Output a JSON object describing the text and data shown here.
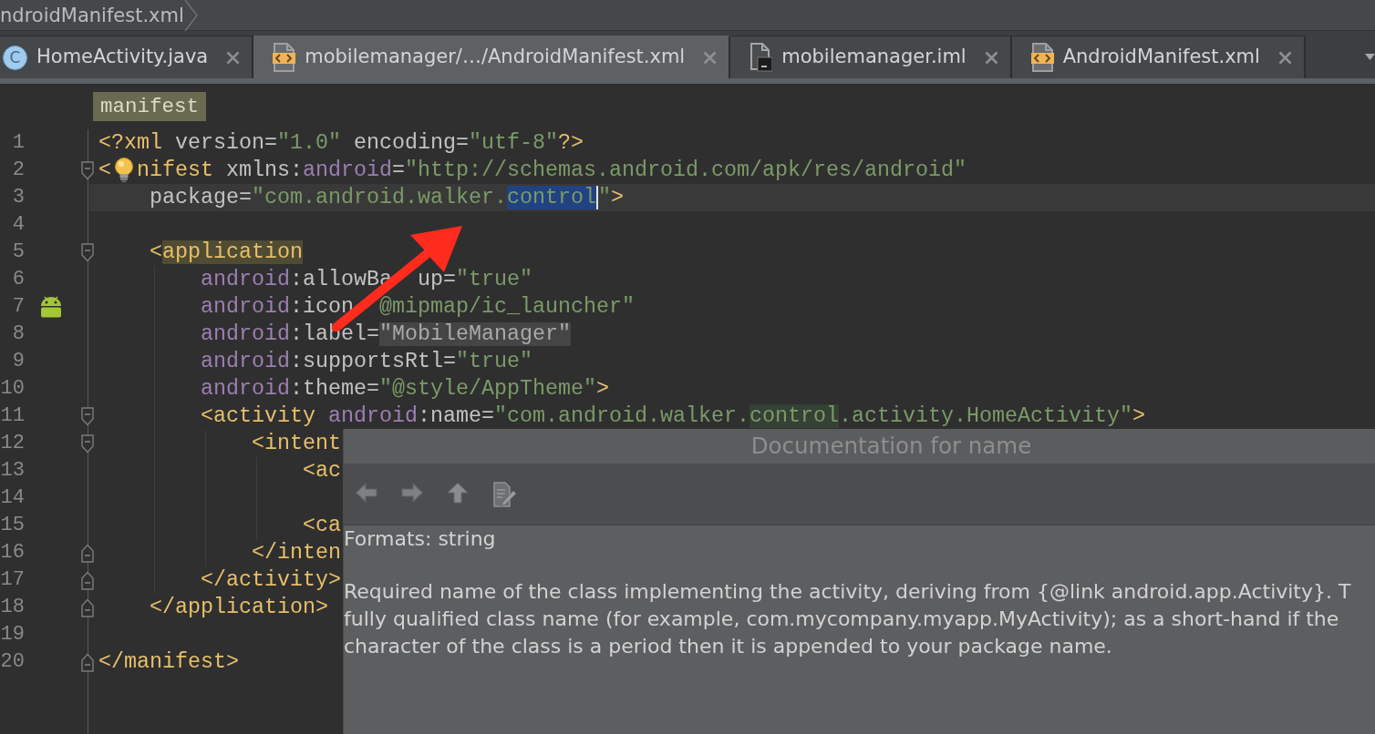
{
  "breadcrumb_bar": {
    "path": "ndroidManifest.xml"
  },
  "tabs": [
    {
      "label": "HomeActivity.java",
      "kind": "class",
      "icon_letter": "C",
      "selected": false
    },
    {
      "label": "mobilemanager/…/AndroidManifest.xml",
      "kind": "xml",
      "selected": true
    },
    {
      "label": "mobilemanager.iml",
      "kind": "module",
      "selected": false
    },
    {
      "label": "AndroidManifest.xml",
      "kind": "xml",
      "selected": false
    }
  ],
  "editor": {
    "breadcrumb_tag": "manifest",
    "lines": [
      {
        "number": "1",
        "current": false,
        "segments": [
          {
            "kind": "tag",
            "text": "<?xml"
          },
          {
            "kind": "plain",
            "text": " version="
          },
          {
            "kind": "value",
            "text": "\"1.0\""
          },
          {
            "kind": "plain",
            "text": " encoding="
          },
          {
            "kind": "value",
            "text": "\"utf-8\""
          },
          {
            "kind": "tag",
            "text": "?>"
          }
        ]
      },
      {
        "number": "2",
        "current": false,
        "fold_marker": {
          "kind": "start"
        },
        "segments": [
          {
            "kind": "tag",
            "text": "<"
          },
          {
            "kind": "bulb"
          },
          {
            "kind": "tag",
            "text": "nifest"
          },
          {
            "kind": "plain",
            "text": " xmlns:"
          },
          {
            "kind": "ns",
            "text": "android"
          },
          {
            "kind": "plain",
            "text": "="
          },
          {
            "kind": "value",
            "text": "\"http://schemas.android.com/apk/res/android\""
          }
        ]
      },
      {
        "number": "3",
        "current": true,
        "segments": [
          {
            "kind": "plain",
            "text": "    package="
          },
          {
            "kind": "value",
            "text": "\"com.android.walker."
          },
          {
            "kind": "value",
            "text": "control",
            "highlight": {
              "kind": "selection"
            }
          },
          {
            "kind": "value",
            "text": "\""
          },
          {
            "kind": "tag",
            "text": ">"
          }
        ]
      },
      {
        "number": "4",
        "current": false
      },
      {
        "number": "5",
        "current": false,
        "fold_marker": {
          "kind": "start"
        },
        "segments": [
          {
            "kind": "tag",
            "text": "    <"
          },
          {
            "kind": "tag",
            "text": "application",
            "highlight": {
              "kind": "tag_match"
            }
          }
        ]
      },
      {
        "number": "6",
        "current": false,
        "segments": [
          {
            "kind": "ns",
            "text": "        android"
          },
          {
            "kind": "plain",
            "text": ":allowBa"
          },
          {
            "kind": "covered"
          },
          {
            "kind": "plain",
            "text": "up="
          },
          {
            "kind": "value",
            "text": "\"true\""
          }
        ]
      },
      {
        "number": "7",
        "current": false,
        "gutter_icon": {
          "kind": "android"
        },
        "segments": [
          {
            "kind": "ns",
            "text": "        android"
          },
          {
            "kind": "plain",
            "text": ":icon"
          },
          {
            "kind": "covered"
          },
          {
            "kind": "value",
            "text": "@mipmap/ic_launcher\""
          }
        ]
      },
      {
        "number": "8",
        "current": false,
        "segments": [
          {
            "kind": "ns",
            "text": "        android"
          },
          {
            "kind": "plain",
            "text": ":label="
          },
          {
            "kind": "value",
            "text": "\"MobileManager\"",
            "highlight": {
              "kind": "folded"
            }
          }
        ]
      },
      {
        "number": "9",
        "current": false,
        "segments": [
          {
            "kind": "ns",
            "text": "        android"
          },
          {
            "kind": "plain",
            "text": ":supportsRtl="
          },
          {
            "kind": "value",
            "text": "\"true\""
          }
        ]
      },
      {
        "number": "10",
        "current": false,
        "segments": [
          {
            "kind": "ns",
            "text": "        android"
          },
          {
            "kind": "plain",
            "text": ":theme="
          },
          {
            "kind": "value",
            "text": "\"@style/AppTheme\""
          },
          {
            "kind": "tag",
            "text": ">"
          }
        ]
      },
      {
        "number": "11",
        "current": false,
        "fold_marker": {
          "kind": "start"
        },
        "segments": [
          {
            "kind": "tag",
            "text": "        <activity "
          },
          {
            "kind": "ns",
            "text": "android"
          },
          {
            "kind": "plain",
            "text": ":name="
          },
          {
            "kind": "value",
            "text": "\"com.android.walker."
          },
          {
            "kind": "value",
            "text": "control",
            "highlight": {
              "kind": "usage"
            }
          },
          {
            "kind": "value",
            "text": ".activity.HomeActivity\""
          },
          {
            "kind": "tag",
            "text": ">"
          }
        ]
      },
      {
        "number": "12",
        "current": false,
        "fold_marker": {
          "kind": "start"
        },
        "segments": [
          {
            "kind": "tag",
            "text": "            <intent"
          }
        ]
      },
      {
        "number": "13",
        "current": false,
        "segments": [
          {
            "kind": "tag",
            "text": "                <ac"
          }
        ]
      },
      {
        "number": "14",
        "current": false
      },
      {
        "number": "15",
        "current": false,
        "segments": [
          {
            "kind": "tag",
            "text": "                <ca"
          }
        ]
      },
      {
        "number": "16",
        "current": false,
        "fold_marker": {
          "kind": "end"
        },
        "segments": [
          {
            "kind": "tag",
            "text": "            </inten"
          }
        ]
      },
      {
        "number": "17",
        "current": false,
        "fold_marker": {
          "kind": "end"
        },
        "segments": [
          {
            "kind": "tag",
            "text": "        </activity>"
          }
        ]
      },
      {
        "number": "18",
        "current": false,
        "fold_marker": {
          "kind": "end"
        },
        "segments": [
          {
            "kind": "tag",
            "text": "    </application>"
          }
        ]
      },
      {
        "number": "19",
        "current": false
      },
      {
        "number": "20",
        "current": false,
        "fold_marker": {
          "kind": "end"
        },
        "segments": [
          {
            "kind": "tag",
            "text": "</manifest>"
          }
        ]
      }
    ]
  },
  "annotations": [
    {
      "kind": "arrow"
    }
  ],
  "documentation_popup": {
    "title": "Documentation for name",
    "toolbar": [
      {
        "kind": "back"
      },
      {
        "kind": "forward"
      },
      {
        "kind": "up"
      },
      {
        "kind": "edit"
      }
    ],
    "formats": "Formats: string",
    "description_lines": [
      "Required name of the class implementing the activity, deriving from {@link android.app.Activity}. T",
      "fully qualified class name (for example, com.mycompany.myapp.MyActivity); as a short-hand if the",
      "character of the class is a period then it is appended to your package name."
    ]
  }
}
